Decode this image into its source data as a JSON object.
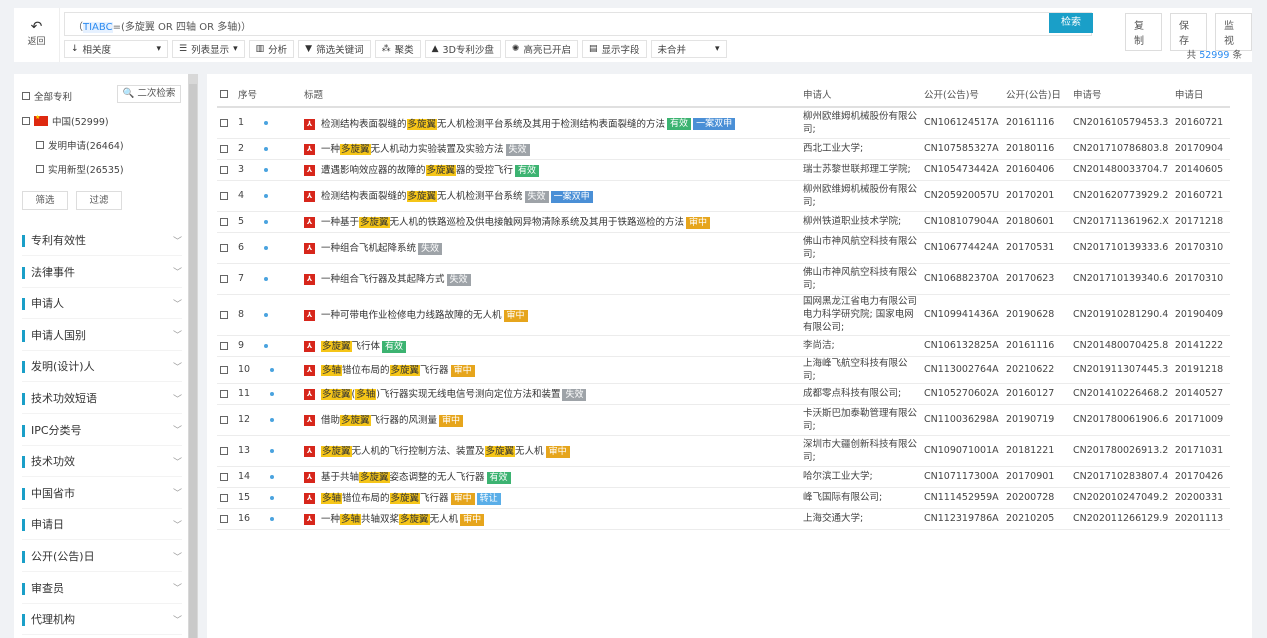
{
  "toolbar": {
    "back_label": "返回",
    "query_prefix": "（",
    "query_field": "TIABC",
    "query_rest": "=(多旋翼 OR 四轴 OR 多轴)）",
    "search_label": "检索",
    "copy_label": "复制",
    "save_label": "保存",
    "monitor_label": "监视",
    "tools": [
      {
        "icon": "sort-icon",
        "label": "相关度"
      },
      {
        "icon": "list-icon",
        "label": "列表显示"
      },
      {
        "icon": "chart-icon",
        "label": "分析"
      },
      {
        "icon": "filter-icon",
        "label": "筛选关键词"
      },
      {
        "icon": "cluster-icon",
        "label": "聚类"
      },
      {
        "icon": "sandbox-icon",
        "label": "3D专利沙盘"
      },
      {
        "icon": "highlight-icon",
        "label": "高亮已开启"
      },
      {
        "icon": "fields-icon",
        "label": "显示字段"
      },
      {
        "icon": "",
        "label": "未合并"
      }
    ],
    "total_prefix": "共",
    "total_count": "52999",
    "total_suffix": "条"
  },
  "sidebar": {
    "all_patents": "全部专利",
    "secondary_search": "二次检索",
    "china": "中国(52999)",
    "invention": "发明申请(26464)",
    "utility": "实用新型(26535)",
    "filter_btn": "筛选",
    "exclude_btn": "过滤",
    "facets": [
      "专利有效性",
      "法律事件",
      "申请人",
      "申请人国别",
      "发明(设计)人",
      "技术功效短语",
      "IPC分类号",
      "技术功效",
      "中国省市",
      "申请日",
      "公开(公告)日",
      "审查员",
      "代理机构"
    ]
  },
  "table": {
    "headers": [
      "序号",
      "标题",
      "申请人",
      "公开(公告)号",
      "公开(公告)日",
      "申请号",
      "申请日"
    ],
    "rows": [
      {
        "no": "1",
        "title": [
          [
            "检测结构表面裂缝的",
            0
          ],
          [
            "多旋翼",
            1
          ],
          [
            "无人机检测平台系统及其用于检测结构表面裂缝的方法",
            0
          ]
        ],
        "tags": [
          [
            "有效",
            "green"
          ],
          [
            "一案双申",
            "blue"
          ]
        ],
        "applicant": "柳州欧维姆机械股份有限公司;",
        "pub_no": "CN106124517A",
        "pub_date": "20161116",
        "app_no": "CN201610579453.3",
        "app_date": "20160721"
      },
      {
        "no": "2",
        "title": [
          [
            "一种",
            0
          ],
          [
            "多旋翼",
            1
          ],
          [
            "无人机动力实验装置及实验方法",
            0
          ]
        ],
        "tags": [
          [
            "失效",
            "gray"
          ]
        ],
        "applicant": "西北工业大学;",
        "pub_no": "CN107585327A",
        "pub_date": "20180116",
        "app_no": "CN201710786803.8",
        "app_date": "20170904"
      },
      {
        "no": "3",
        "title": [
          [
            "遭遇影响效应器的故障的",
            0
          ],
          [
            "多旋翼",
            1
          ],
          [
            "器的受控飞行",
            0
          ]
        ],
        "tags": [
          [
            "有效",
            "green"
          ]
        ],
        "applicant": "瑞士苏黎世联邦理工学院;",
        "pub_no": "CN105473442A",
        "pub_date": "20160406",
        "app_no": "CN201480033704.7",
        "app_date": "20140605"
      },
      {
        "no": "4",
        "title": [
          [
            "检测结构表面裂缝的",
            0
          ],
          [
            "多旋翼",
            1
          ],
          [
            "无人机检测平台系统",
            0
          ]
        ],
        "tags": [
          [
            "失效",
            "gray"
          ],
          [
            "一案双申",
            "blue"
          ]
        ],
        "applicant": "柳州欧维姆机械股份有限公司;",
        "pub_no": "CN205920057U",
        "pub_date": "20170201",
        "app_no": "CN201620773929.2",
        "app_date": "20160721"
      },
      {
        "no": "5",
        "title": [
          [
            "一种基于",
            0
          ],
          [
            "多旋翼",
            1
          ],
          [
            "无人机的铁路巡检及供电接触网异物清除系统及其用于铁路巡检的方法",
            0
          ]
        ],
        "tags": [
          [
            "审中",
            "orange"
          ]
        ],
        "applicant": "柳州铁道职业技术学院;",
        "pub_no": "CN108107904A",
        "pub_date": "20180601",
        "app_no": "CN201711361962.X",
        "app_date": "20171218"
      },
      {
        "no": "6",
        "title": [
          [
            "一种组合飞机起降系统",
            0
          ]
        ],
        "tags": [
          [
            "失效",
            "gray"
          ]
        ],
        "applicant": "佛山市神风航空科技有限公司;",
        "pub_no": "CN106774424A",
        "pub_date": "20170531",
        "app_no": "CN201710139333.6",
        "app_date": "20170310"
      },
      {
        "no": "7",
        "title": [
          [
            "一种组合飞行器及其起降方式",
            0
          ]
        ],
        "tags": [
          [
            "失效",
            "gray"
          ]
        ],
        "applicant": "佛山市神风航空科技有限公司;",
        "pub_no": "CN106882370A",
        "pub_date": "20170623",
        "app_no": "CN201710139340.6",
        "app_date": "20170310"
      },
      {
        "no": "8",
        "title": [
          [
            "一种可带电作业检修电力线路故障的无人机",
            0
          ]
        ],
        "tags": [
          [
            "审中",
            "orange"
          ]
        ],
        "applicant": "国网黑龙江省电力有限公司电力科学研究院; 国家电网有限公司;",
        "pub_no": "CN109941436A",
        "pub_date": "20190628",
        "app_no": "CN201910281290.4",
        "app_date": "20190409"
      },
      {
        "no": "9",
        "title": [
          [
            "多旋翼",
            1
          ],
          [
            "飞行体",
            0
          ]
        ],
        "tags": [
          [
            "有效",
            "green"
          ]
        ],
        "applicant": "李尚洁;",
        "pub_no": "CN106132825A",
        "pub_date": "20161116",
        "app_no": "CN201480070425.8",
        "app_date": "20141222"
      },
      {
        "no": "10",
        "title": [
          [
            "多轴",
            1
          ],
          [
            "错位布局的",
            0
          ],
          [
            "多旋翼",
            1
          ],
          [
            "飞行器",
            0
          ]
        ],
        "tags": [
          [
            "审中",
            "orange"
          ]
        ],
        "applicant": "上海峰飞航空科技有限公司;",
        "pub_no": "CN113002764A",
        "pub_date": "20210622",
        "app_no": "CN201911307445.3",
        "app_date": "20191218"
      },
      {
        "no": "11",
        "title": [
          [
            "多旋翼",
            1
          ],
          [
            "(",
            0
          ],
          [
            "多轴",
            1
          ],
          [
            ")飞行器实现无线电信号测向定位方法和装置",
            0
          ]
        ],
        "tags": [
          [
            "失效",
            "gray"
          ]
        ],
        "applicant": "成都零点科技有限公司;",
        "pub_no": "CN105270602A",
        "pub_date": "20160127",
        "app_no": "CN201410226468.2",
        "app_date": "20140527"
      },
      {
        "no": "12",
        "title": [
          [
            "借助",
            0
          ],
          [
            "多旋翼",
            1
          ],
          [
            "飞行器的风测量",
            0
          ]
        ],
        "tags": [
          [
            "审中",
            "orange"
          ]
        ],
        "applicant": "卡沃斯巴加泰勒管理有限公司;",
        "pub_no": "CN110036298A",
        "pub_date": "20190719",
        "app_no": "CN201780061906.6",
        "app_date": "20171009"
      },
      {
        "no": "13",
        "title": [
          [
            "多旋翼",
            1
          ],
          [
            "无人机的飞行控制方法、装置及",
            0
          ],
          [
            "多旋翼",
            1
          ],
          [
            "无人机",
            0
          ]
        ],
        "tags": [
          [
            "审中",
            "orange"
          ]
        ],
        "applicant": "深圳市大疆创新科技有限公司;",
        "pub_no": "CN109071001A",
        "pub_date": "20181221",
        "app_no": "CN201780026913.2",
        "app_date": "20171031"
      },
      {
        "no": "14",
        "title": [
          [
            "基于共轴",
            0
          ],
          [
            "多旋翼",
            1
          ],
          [
            "姿态调整的无人飞行器",
            0
          ]
        ],
        "tags": [
          [
            "有效",
            "green"
          ]
        ],
        "applicant": "哈尔滨工业大学;",
        "pub_no": "CN107117300A",
        "pub_date": "20170901",
        "app_no": "CN201710283807.4",
        "app_date": "20170426"
      },
      {
        "no": "15",
        "title": [
          [
            "多轴",
            1
          ],
          [
            "错位布局的",
            0
          ],
          [
            "多旋翼",
            1
          ],
          [
            "飞行器",
            0
          ]
        ],
        "tags": [
          [
            "审中",
            "orange"
          ],
          [
            "转让",
            "lblue"
          ]
        ],
        "applicant": "峰飞国际有限公司;",
        "pub_no": "CN111452959A",
        "pub_date": "20200728",
        "app_no": "CN202010247049.2",
        "app_date": "20200331"
      },
      {
        "no": "16",
        "title": [
          [
            "一种",
            0
          ],
          [
            "多轴",
            1
          ],
          [
            "共轴双桨",
            0
          ],
          [
            "多旋翼",
            1
          ],
          [
            "无人机",
            0
          ]
        ],
        "tags": [
          [
            "审中",
            "orange"
          ]
        ],
        "applicant": "上海交通大学;",
        "pub_no": "CN112319786A",
        "pub_date": "20210205",
        "app_no": "CN202011266129.9",
        "app_date": "20201113"
      }
    ]
  }
}
